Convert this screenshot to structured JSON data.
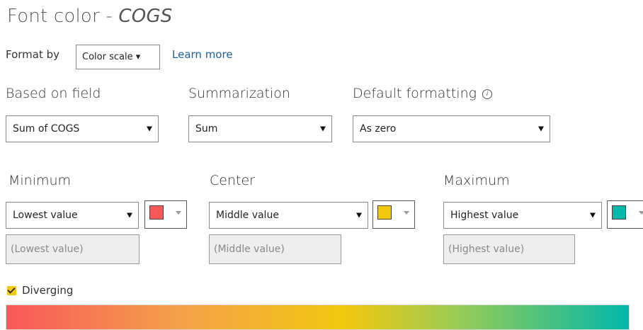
{
  "title": {
    "prefix": "Font color - ",
    "field": "COGS"
  },
  "format_by": {
    "label": "Format by",
    "value": "Color scale ▾",
    "learn_more": "Learn more"
  },
  "based_on_field": {
    "label": "Based on field",
    "value": "Sum of COGS"
  },
  "summarization": {
    "label": "Summarization",
    "value": "Sum"
  },
  "default_formatting": {
    "label": "Default formatting",
    "value": "As zero",
    "info_icon": "ⓘ"
  },
  "minimum": {
    "label": "Minimum",
    "value": "Lowest value",
    "placeholder": "(Lowest value)",
    "color": "#f8585a"
  },
  "center": {
    "label": "Center",
    "value": "Middle value",
    "placeholder": "(Middle value)",
    "color": "#f2c80f"
  },
  "maximum": {
    "label": "Maximum",
    "value": "Highest value",
    "placeholder": "(Highest value)",
    "color": "#01b8aa"
  },
  "diverging": {
    "label": "Diverging",
    "checked": true
  },
  "gradient_colors": [
    "#f8585a",
    "#f2c80f",
    "#01b8aa"
  ]
}
